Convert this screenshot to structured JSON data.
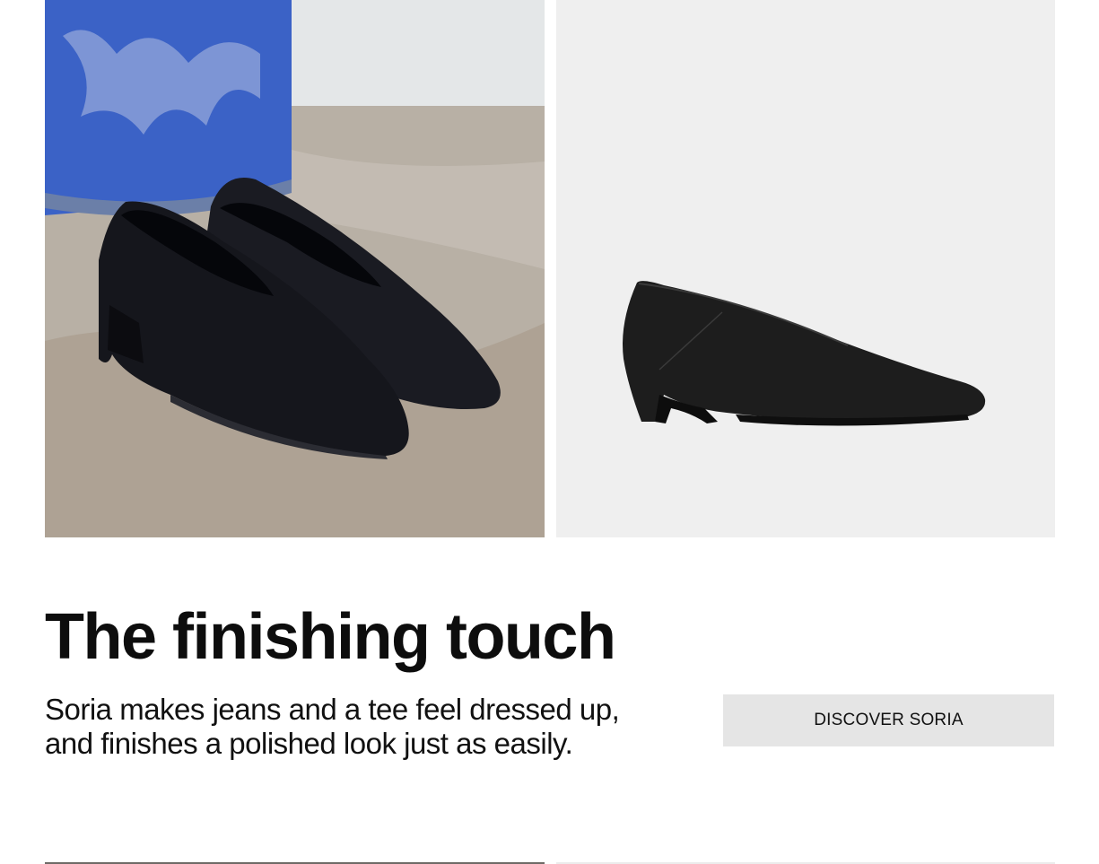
{
  "feature": {
    "lifestyle_image": {
      "icon": "shoe-pair-lifestyle-image",
      "background_wall": "#e6e9ea",
      "floor_color": "#b9b1a6",
      "vase_color": "#3a63c8",
      "shoe_color": "#15161c"
    },
    "product_image": {
      "icon": "shoe-product-image",
      "background": "#efefef",
      "shoe_color": "#1c1c1c"
    },
    "title": "The finishing touch",
    "description_line1": "Soria makes jeans and a tee feel dressed up,",
    "description_line2": "and finishes a polished look just as easily.",
    "cta_label": "DISCOVER SORIA",
    "cta_background": "#e5e5e5"
  }
}
